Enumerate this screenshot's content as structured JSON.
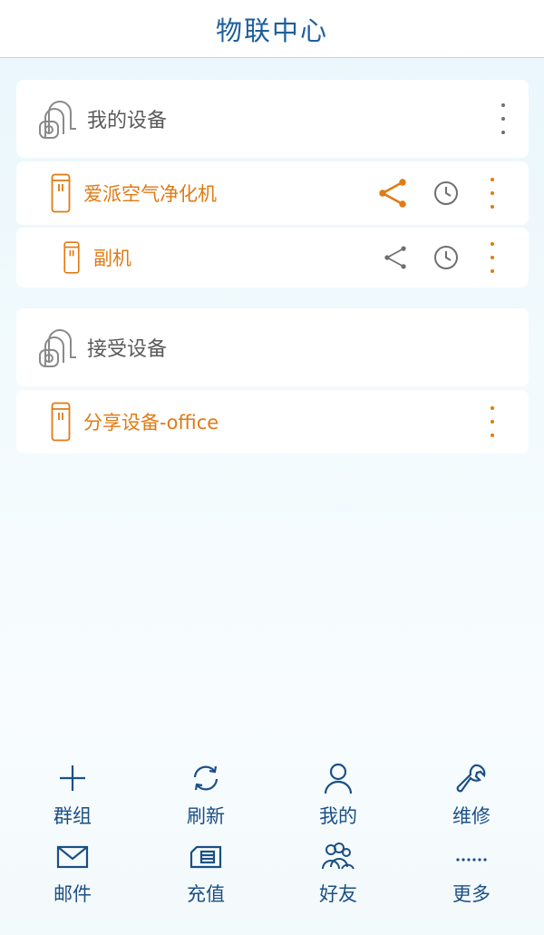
{
  "header": {
    "title": "物联中心"
  },
  "groups": [
    {
      "title": "我的设备",
      "devices": [
        {
          "label": "爱派空气净化机",
          "share_active": true
        },
        {
          "label": "副机",
          "share_active": false
        }
      ]
    },
    {
      "title": "接受设备",
      "devices": [
        {
          "label": "分享设备-office"
        }
      ]
    }
  ],
  "bottom_menu": [
    {
      "label": "群组",
      "icon": "plus-icon"
    },
    {
      "label": "刷新",
      "icon": "refresh-icon"
    },
    {
      "label": "我的",
      "icon": "person-icon"
    },
    {
      "label": "维修",
      "icon": "wrench-icon"
    },
    {
      "label": "邮件",
      "icon": "mail-icon"
    },
    {
      "label": "充值",
      "icon": "recharge-card-icon"
    },
    {
      "label": "好友",
      "icon": "friends-icon"
    },
    {
      "label": "更多",
      "icon": "more-dots-icon"
    }
  ],
  "colors": {
    "accent_orange": "#e07a14",
    "title_blue": "#1d5f9e",
    "menu_blue": "#1b4f86",
    "icon_gray": "#6f6f6f"
  }
}
